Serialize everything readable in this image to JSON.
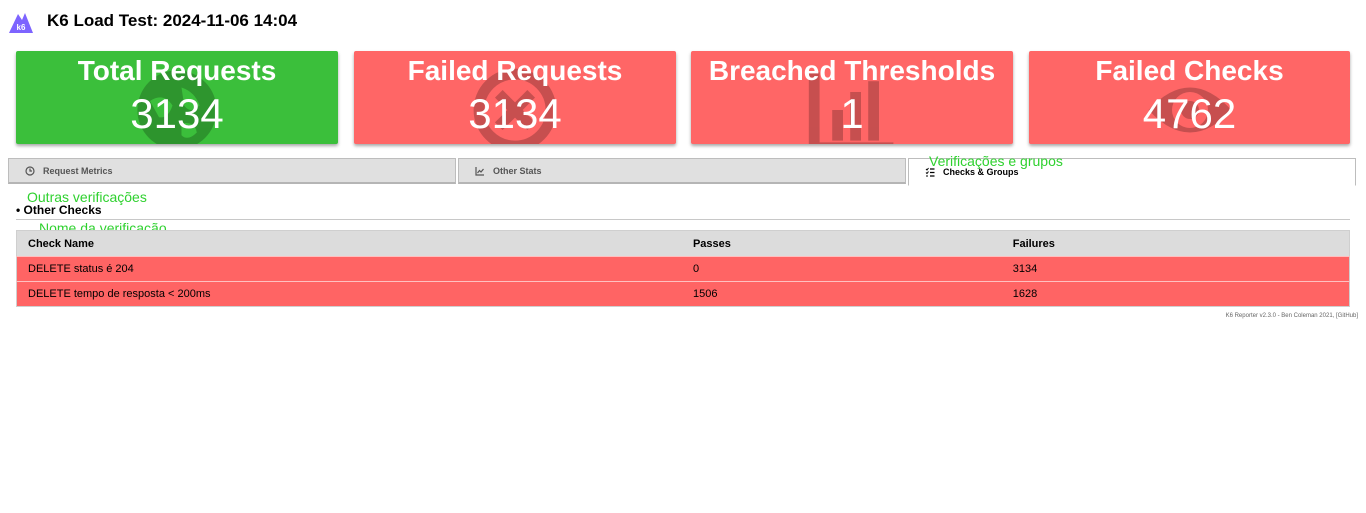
{
  "header": {
    "title": "K6 Load Test: 2024-11-06 14:04",
    "logo_text": "k6"
  },
  "cards": [
    {
      "label": "Total Requests",
      "value": "3134",
      "color": "#3bbf3b",
      "icon": "globe-icon"
    },
    {
      "label": "Failed Requests",
      "value": "3134",
      "color": "#ff6666",
      "icon": "x-circle-icon"
    },
    {
      "label": "Breached Thresholds",
      "value": "1",
      "color": "#ff6666",
      "icon": "chart-icon"
    },
    {
      "label": "Failed Checks",
      "value": "4762",
      "color": "#ff6666",
      "icon": "eye-icon"
    }
  ],
  "tabs": [
    {
      "label": "Request Metrics",
      "icon": "clock-icon",
      "active": false
    },
    {
      "label": "Other Stats",
      "icon": "line-chart-icon",
      "active": false
    },
    {
      "label": "Checks & Groups",
      "icon": "list-check-icon",
      "active": true
    }
  ],
  "annotations": {
    "checks_groups": "Verificações e grupos",
    "other_checks": "Outras verificações",
    "check_name": "Nome da verificação"
  },
  "section": {
    "title": "• Other Checks"
  },
  "table": {
    "headers": [
      "Check Name",
      "Passes",
      "Failures"
    ],
    "rows": [
      [
        "DELETE status é 204",
        "0",
        "3134"
      ],
      [
        "DELETE tempo de resposta < 200ms",
        "1506",
        "1628"
      ]
    ]
  },
  "footer": "K6 Reporter v2.3.0 - Ben Coleman 2021, [GitHub]",
  "colors": {
    "success": "#3bbf3b",
    "failure": "#ff6666",
    "annotation": "#2fd12f"
  }
}
